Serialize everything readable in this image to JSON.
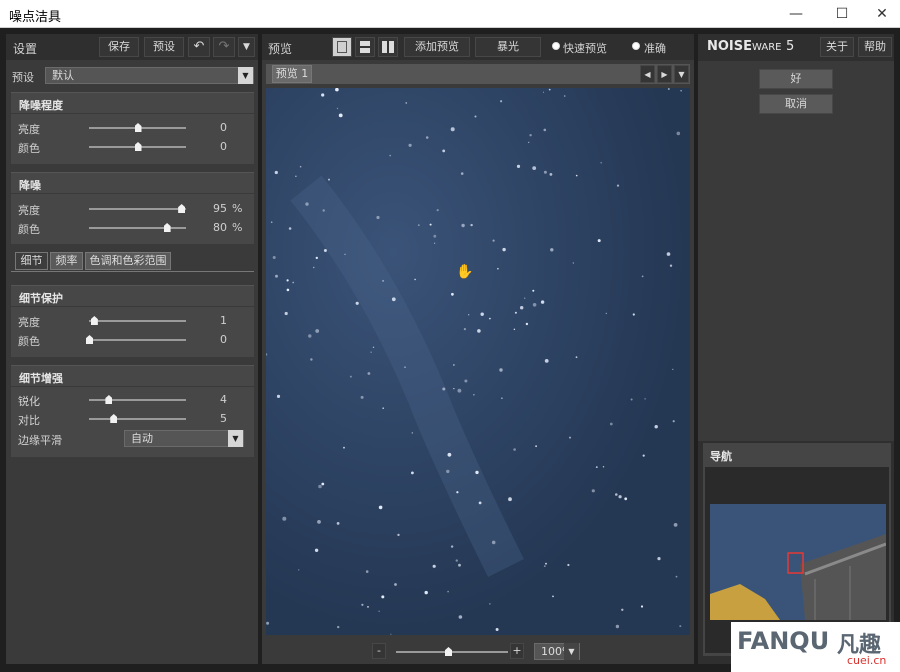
{
  "window": {
    "title": "噪点洁具",
    "minimize": "—",
    "maximize": "☐",
    "close": "✕"
  },
  "left": {
    "header_title": "设置",
    "save_label": "保存",
    "presets_label": "预设",
    "undo_icon": "undo-icon",
    "redo_icon": "redo-icon",
    "preset_label": "预设",
    "preset_value": "默认",
    "noise_level": {
      "title": "降噪程度",
      "rows": [
        {
          "label": "亮度",
          "value": "0",
          "fraction": 0.5
        },
        {
          "label": "颜色",
          "value": "0",
          "fraction": 0.5
        }
      ]
    },
    "noise_reduction": {
      "title": "降噪",
      "rows": [
        {
          "label": "亮度",
          "value": "95",
          "unit": "%",
          "fraction": 0.95
        },
        {
          "label": "颜色",
          "value": "80",
          "unit": "%",
          "fraction": 0.8
        }
      ]
    },
    "tabs": [
      "细节",
      "频率",
      "色调和色彩范围"
    ],
    "detail_protection": {
      "title": "细节保护",
      "rows": [
        {
          "label": "亮度",
          "value": "1",
          "fraction": 0.05
        },
        {
          "label": "颜色",
          "value": "0",
          "fraction": 0.0
        }
      ]
    },
    "detail_enhance": {
      "title": "细节增强",
      "rows": [
        {
          "label": "锐化",
          "value": "4",
          "fraction": 0.2
        },
        {
          "label": "对比",
          "value": "5",
          "fraction": 0.25
        }
      ],
      "edge_label": "边缘平滑",
      "edge_value": "自动"
    }
  },
  "center": {
    "title": "预览",
    "add_preview": "添加预览",
    "exposure": "暴光",
    "fast_preview": "快速预览",
    "accurate": "准确",
    "tab_label": "预览 1",
    "zoom_value": "100%",
    "zoom_minus": "-",
    "zoom_plus": "+"
  },
  "right": {
    "logo_bold": "NOISE",
    "logo_light": "WARE",
    "logo_version": "5",
    "about": "关于",
    "help": "帮助",
    "ok": "好",
    "cancel": "取消",
    "navigator": "导航"
  },
  "watermark": {
    "brand": "FANQU",
    "cn": "凡趣",
    "domain": "cuei.cn"
  },
  "colors": {
    "sky": "#2e4263",
    "accent": "#e53935",
    "panel": "#474747"
  }
}
